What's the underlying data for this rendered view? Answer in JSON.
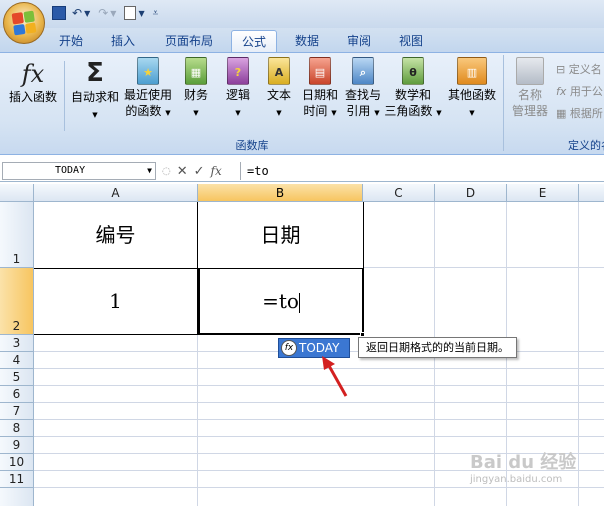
{
  "ribbon_tabs": [
    "开始",
    "插入",
    "页面布局",
    "公式",
    "数据",
    "审阅",
    "视图"
  ],
  "active_tab": "公式",
  "ribbon": {
    "insert_function": "插入函数",
    "autosum_l1": "自动求和",
    "recent_l1": "最近使用",
    "recent_l2": "的函数",
    "finance": "财务",
    "logic": "逻辑",
    "text": "文本",
    "datetime_l1": "日期和",
    "datetime_l2": "时间",
    "lookup_l1": "查找与",
    "lookup_l2": "引用",
    "math_l1": "数学和",
    "math_l2": "三角函数",
    "other": "其他函数",
    "group_function_library": "函数库",
    "name_manager_l1": "名称",
    "name_manager_l2": "管理器",
    "define_name": "定义名",
    "use_in_formula": "用于公",
    "create_from_selection": "根据所",
    "group_defined_names": "定义的名"
  },
  "icons": {
    "fx": "fx",
    "sigma": "Σ",
    "star": "★",
    "question": "?",
    "letter_a": "A",
    "theta": "θ"
  },
  "name_box": "TODAY",
  "formula_bar": "=to",
  "columns": [
    "A",
    "B",
    "C",
    "D",
    "E"
  ],
  "rows": [
    "1",
    "2",
    "3",
    "4",
    "5",
    "6",
    "7",
    "8",
    "9",
    "10",
    "11"
  ],
  "cells": {
    "A1": "编号",
    "B1": "日期",
    "A2": "1",
    "B2": "=to"
  },
  "autocomplete": {
    "item": "TODAY",
    "tooltip": "返回日期格式的的当前日期。"
  },
  "watermark": {
    "line1": "Bai du 经验",
    "line2": "jingyan.baidu.com"
  },
  "colors": {
    "selected_header": "#f7c560",
    "autocomplete_bg": "#3b77d2",
    "arrow": "#d32020"
  }
}
